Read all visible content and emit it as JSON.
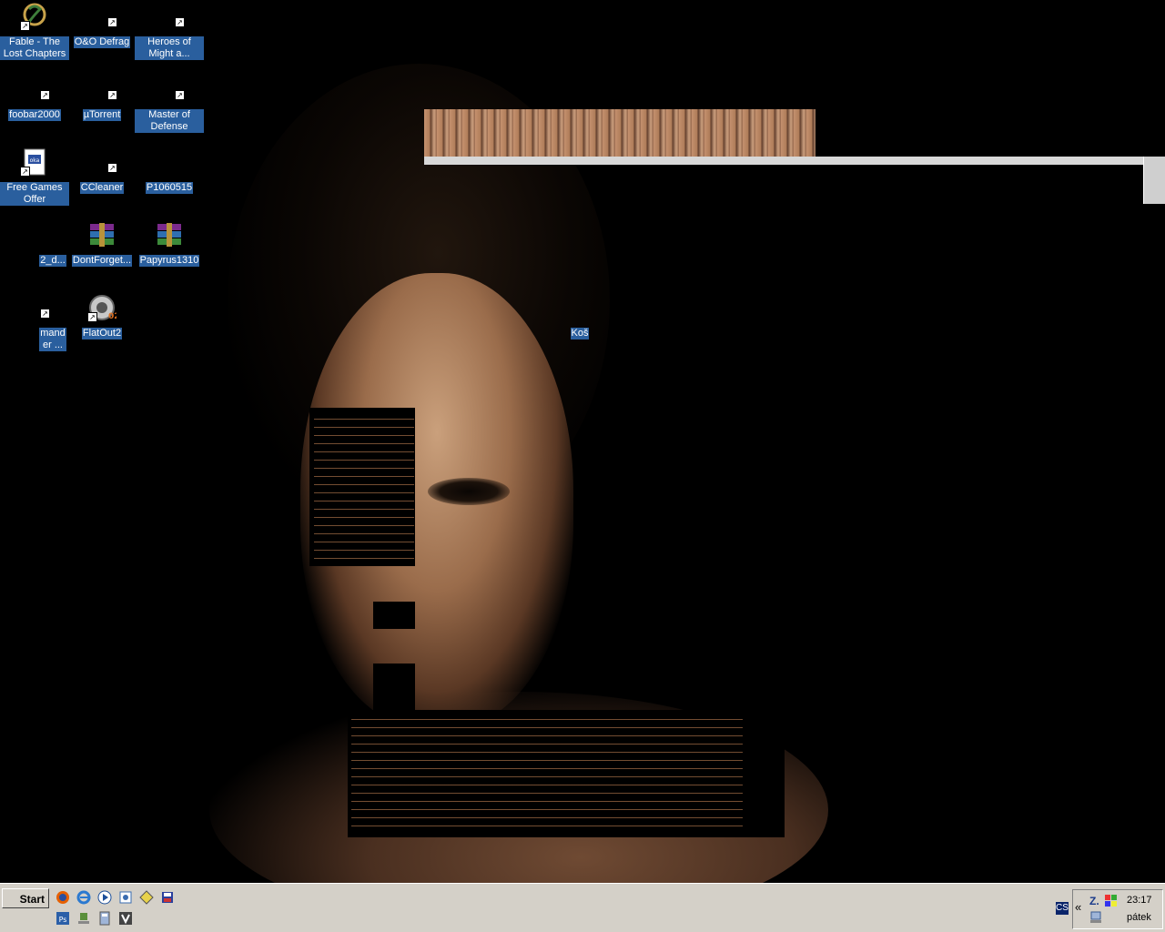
{
  "desktop": {
    "icons": [
      {
        "label": "Fable - The Lost Chapters",
        "icon": "fable-icon",
        "shortcut": true
      },
      {
        "label": "O&O Defrag",
        "icon": "defrag-icon",
        "shortcut": true
      },
      {
        "label": "Heroes of Might a...",
        "icon": "heroes-icon",
        "shortcut": true
      },
      {
        "label": "foobar2000",
        "icon": "foobar-icon",
        "shortcut": true
      },
      {
        "label": "µTorrent",
        "icon": "utorrent-icon",
        "shortcut": true
      },
      {
        "label": "Master of Defense",
        "icon": "master-of-defense-icon",
        "shortcut": true
      },
      {
        "label": "Free Games Offer",
        "icon": "document-icon",
        "shortcut": true
      },
      {
        "label": "CCleaner",
        "icon": "ccleaner-icon",
        "shortcut": true
      },
      {
        "label": "P1060515",
        "icon": "image-icon",
        "shortcut": false
      },
      {
        "label": "2_d...",
        "icon": "file-icon",
        "shortcut": false
      },
      {
        "label": "DontForget...",
        "icon": "winrar-archive-icon",
        "shortcut": false
      },
      {
        "label": "Papyrus1310",
        "icon": "winrar-archive-icon",
        "shortcut": false
      },
      {
        "label": "mand\ner ...",
        "icon": "command-icon",
        "shortcut": true
      },
      {
        "label": "FlatOut2",
        "icon": "flatout-icon",
        "shortcut": true
      },
      {
        "label": "Koš",
        "icon": "recycle-bin-icon",
        "shortcut": false
      }
    ]
  },
  "taskbar": {
    "start_label": "Start",
    "quick_launch": [
      {
        "name": "firefox-icon"
      },
      {
        "name": "internet-explorer-icon"
      },
      {
        "name": "media-player-icon"
      },
      {
        "name": "browser-icon"
      },
      {
        "name": "tool-icon"
      },
      {
        "name": "save-icon"
      },
      {
        "name": "photoshop-icon"
      },
      {
        "name": "network-icon"
      },
      {
        "name": "calculator-icon"
      },
      {
        "name": "app-icon"
      }
    ],
    "tray": {
      "lang": "CS",
      "expand": "«",
      "time": "23:17",
      "day": "pátek"
    }
  }
}
